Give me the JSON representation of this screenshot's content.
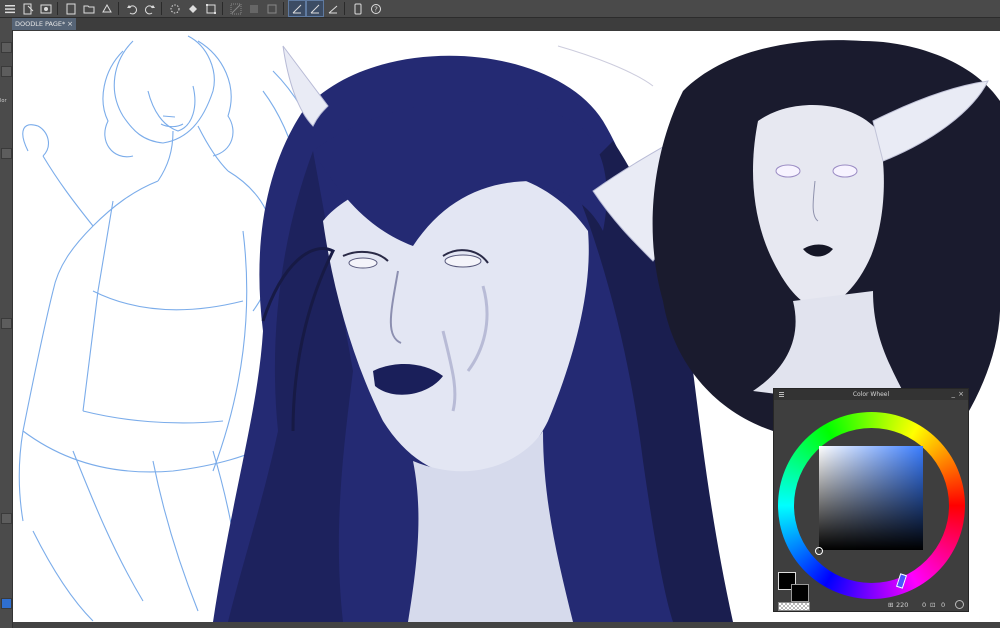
{
  "toolbar": {
    "icons": [
      "menu-icon",
      "new-file-icon",
      "view-icon",
      "open-folder-icon",
      "save-icon",
      "undo-icon",
      "redo-icon",
      "loading-icon",
      "fill-icon",
      "transform-icon",
      "select-icon",
      "select-rect-icon",
      "select-invert-icon",
      "ruler-icon",
      "ruler-snap-icon",
      "ruler-special-icon",
      "device-icon",
      "help-icon"
    ]
  },
  "tab": {
    "label": "DOODLE PAGE*",
    "close": "×"
  },
  "left_strip": {
    "label": "lor"
  },
  "color_wheel": {
    "title": "Color Wheel",
    "minimize": "_",
    "close": "×",
    "main_color": "#000000",
    "sub_color": "#000000",
    "hue_color": "#3a7dff",
    "zoom_value": "220",
    "value_a": "0",
    "value_b": "0"
  },
  "bottom_bar": {
    "text": ""
  },
  "colors": {
    "sketch_blue": "#6da4e8",
    "hair_navy": "#242a73",
    "hair_black": "#1a1b2e",
    "skin_pale": "#e3e6f3"
  }
}
